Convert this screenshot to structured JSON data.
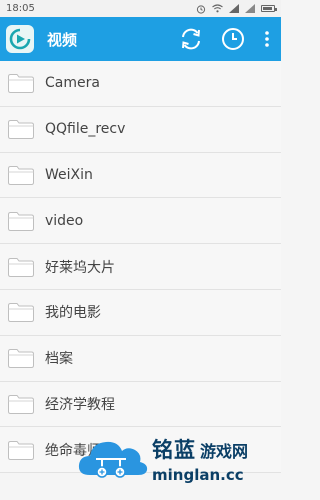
{
  "status": {
    "time": "18:05"
  },
  "app": {
    "title": "视频"
  },
  "colors": {
    "appbar": "#1e9fe3",
    "status_bg": "#f2f2f2",
    "row_bg": "#f7f7f7",
    "text": "#444444"
  },
  "folders": [
    "Camera",
    "QQfile_recv",
    "WeiXin",
    "video",
    "好莱坞大片",
    "我的电影",
    "档案",
    "经济学教程",
    "绝命毒师"
  ],
  "watermark": {
    "brand": "铭蓝",
    "site": "游戏网",
    "domain": "minglan.cc"
  },
  "icons": {
    "logo": "video-player-logo-icon",
    "sync": "sync-icon",
    "history": "clock-icon",
    "menu": "more-vert-icon",
    "folder": "folder-icon"
  }
}
